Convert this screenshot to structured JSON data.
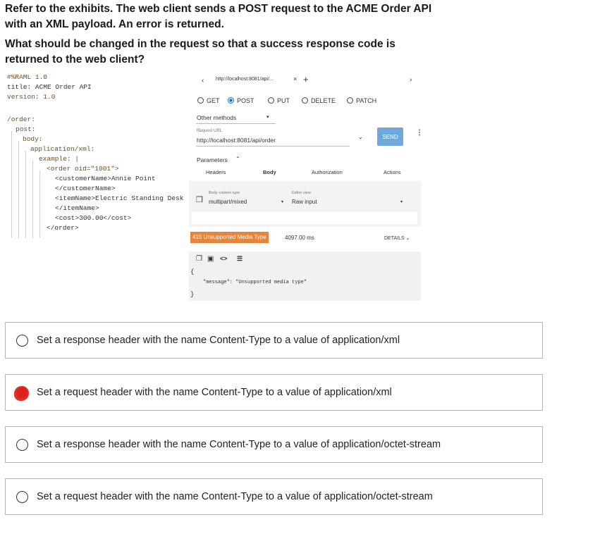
{
  "question": {
    "intro": "Refer to the exhibits. The web client sends a POST request to the ACME Order API with an XML payload. An error is returned.",
    "prompt": "What should be changed in the request so that a success response code is returned to the web client?"
  },
  "raml": {
    "lines": [
      "#%RAML 1.0",
      "title: ACME Order API",
      "version: 1.0",
      "/order:",
      "post:",
      "body:",
      "application/xml:",
      "example: |",
      "<order oid=\"1001\">",
      "<customerName>Annie Point",
      "</customerName>",
      "<itemName>Electric Standing Desk",
      "</itemName>",
      "<cost>300.00</cost>",
      "</order>"
    ]
  },
  "client": {
    "tab_title": "http://localhost:8081/api/...",
    "methods": [
      "GET",
      "POST",
      "PUT",
      "DELETE",
      "PATCH"
    ],
    "selected_method": "POST",
    "other_methods": "Other methods",
    "request_url_label": "Request URL",
    "request_url": "http://localhost:8081/api/order",
    "send": "SEND",
    "parameters_label": "Parameters",
    "param_tabs": [
      "Headers",
      "Body",
      "Authorization",
      "Actions"
    ],
    "body_content_type_label": "Body content type",
    "body_content_type": "multipart/mixed",
    "editor_view_label": "Editor view",
    "editor_view": "Raw input",
    "status": "415 Unsupported Media Type",
    "timing": "4097.00 ms",
    "details": "DETAILS",
    "response_open": "{",
    "response_line": "\"message\": \"Unsupported media type\"",
    "response_close": "}"
  },
  "options": [
    {
      "label": "Set a response header with the name Content-Type to a value of application/xml",
      "selected": false
    },
    {
      "label": "Set a request header with the name Content-Type to a value of application/xml",
      "selected": true
    },
    {
      "label": "Set a response header with the name Content-Type to a value of application/octet-stream",
      "selected": false
    },
    {
      "label": "Set a request header with the name Content-Type to a value of application/octet-stream",
      "selected": false
    }
  ],
  "colors": {
    "send_button": "#6fa8dc",
    "status_badge": "#e8833a",
    "selected_radio": "#1a73c9",
    "answer_mark": "#e0201a"
  }
}
